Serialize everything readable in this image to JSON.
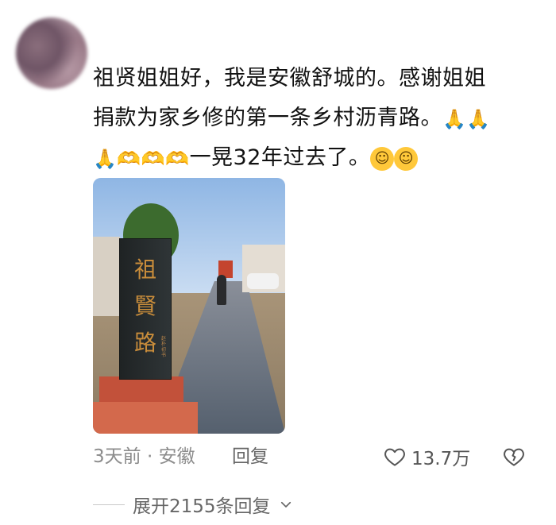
{
  "comment": {
    "line1": "祖贤姐姐好，我是安徽舒城的。感谢姐姐",
    "line2_text": "捐款为家乡修的第一条乡村沥青路。",
    "line3_text": "一晃32年过去了。",
    "emoji": {
      "pray": "🙏",
      "heart_hands": "🫶",
      "smile": "☺"
    }
  },
  "photo": {
    "stele_text": "祖\n賢\n路",
    "stele_small": "赵朴初书"
  },
  "meta": {
    "time_location": "3天前 · 安徽",
    "reply_label": "回复"
  },
  "actions": {
    "like_count": "13.7万"
  },
  "expand": {
    "label": "展开2155条回复"
  },
  "colors": {
    "text": "#111111",
    "meta": "#8c8c8c",
    "stele_gold": "#c98d3b"
  }
}
